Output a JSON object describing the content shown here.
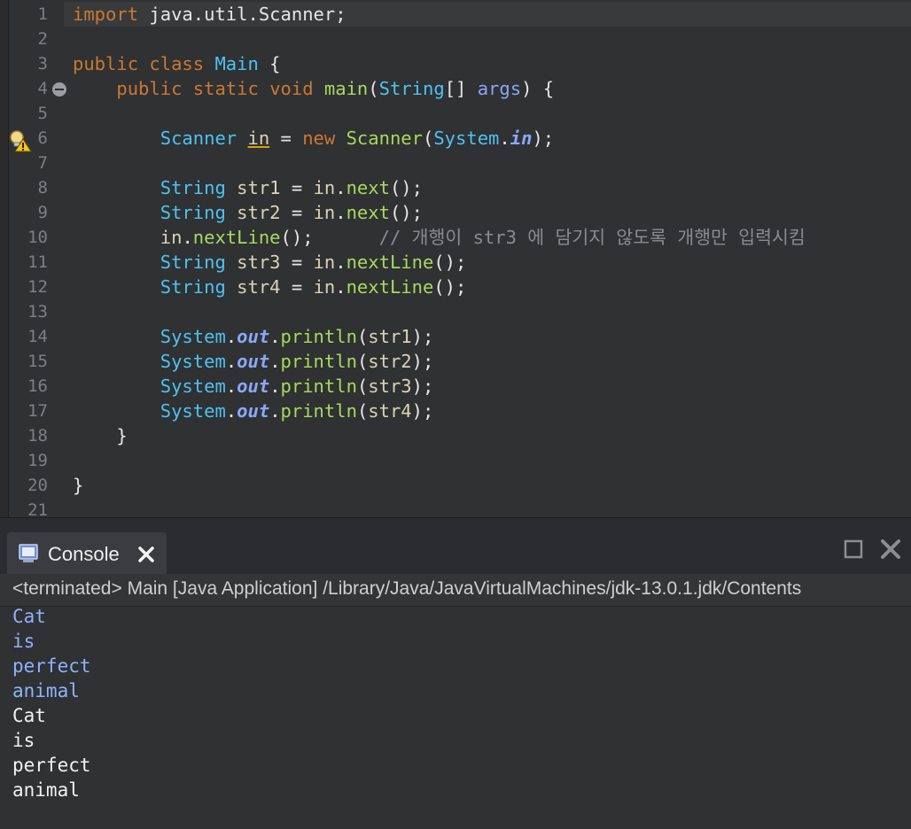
{
  "editor": {
    "line_numbers": [
      "1",
      "2",
      "3",
      "4",
      "5",
      "6",
      "7",
      "8",
      "9",
      "10",
      "11",
      "12",
      "13",
      "14",
      "15",
      "16",
      "17",
      "18",
      "19",
      "20",
      "21"
    ],
    "lines": {
      "l1": [
        [
          "kw",
          "import"
        ],
        [
          "p",
          " java.util.Scanner;"
        ]
      ],
      "l3": [
        [
          "kw",
          "public"
        ],
        [
          "p",
          " "
        ],
        [
          "kw",
          "class"
        ],
        [
          "p",
          " "
        ],
        [
          "ty",
          "Main"
        ],
        [
          "p",
          " {"
        ]
      ],
      "l4": [
        [
          "p",
          "    "
        ],
        [
          "kw",
          "public"
        ],
        [
          "p",
          " "
        ],
        [
          "kw",
          "static"
        ],
        [
          "p",
          " "
        ],
        [
          "kw",
          "void"
        ],
        [
          "p",
          " "
        ],
        [
          "mth",
          "main"
        ],
        [
          "p",
          "("
        ],
        [
          "ty",
          "String"
        ],
        [
          "p",
          "[] "
        ],
        [
          "arg",
          "args"
        ],
        [
          "p",
          ") {"
        ]
      ],
      "l6": [
        [
          "p",
          "        "
        ],
        [
          "ty",
          "Scanner"
        ],
        [
          "p",
          " "
        ],
        [
          "warnvar",
          "in"
        ],
        [
          "p",
          " = "
        ],
        [
          "kw",
          "new"
        ],
        [
          "p",
          " "
        ],
        [
          "cls",
          "Scanner"
        ],
        [
          "p",
          "("
        ],
        [
          "ty",
          "System"
        ],
        [
          "p",
          "."
        ],
        [
          "it",
          "in"
        ],
        [
          "p",
          ");"
        ]
      ],
      "l8": [
        [
          "p",
          "        "
        ],
        [
          "ty",
          "String"
        ],
        [
          "p",
          " "
        ],
        [
          "var",
          "str1"
        ],
        [
          "p",
          " = "
        ],
        [
          "var",
          "in"
        ],
        [
          "p",
          "."
        ],
        [
          "mth",
          "next"
        ],
        [
          "p",
          "();"
        ]
      ],
      "l9": [
        [
          "p",
          "        "
        ],
        [
          "ty",
          "String"
        ],
        [
          "p",
          " "
        ],
        [
          "var",
          "str2"
        ],
        [
          "p",
          " = "
        ],
        [
          "var",
          "in"
        ],
        [
          "p",
          "."
        ],
        [
          "mth",
          "next"
        ],
        [
          "p",
          "();"
        ]
      ],
      "l10": [
        [
          "p",
          "        "
        ],
        [
          "var",
          "in"
        ],
        [
          "p",
          "."
        ],
        [
          "mth",
          "nextLine"
        ],
        [
          "p",
          "();      "
        ],
        [
          "cmt",
          "// 개행이 str3 에 담기지 않도록 개행만 입력시킴"
        ]
      ],
      "l11": [
        [
          "p",
          "        "
        ],
        [
          "ty",
          "String"
        ],
        [
          "p",
          " "
        ],
        [
          "var",
          "str3"
        ],
        [
          "p",
          " = "
        ],
        [
          "var",
          "in"
        ],
        [
          "p",
          "."
        ],
        [
          "mth",
          "nextLine"
        ],
        [
          "p",
          "();"
        ]
      ],
      "l12": [
        [
          "p",
          "        "
        ],
        [
          "ty",
          "String"
        ],
        [
          "p",
          " "
        ],
        [
          "var",
          "str4"
        ],
        [
          "p",
          " = "
        ],
        [
          "var",
          "in"
        ],
        [
          "p",
          "."
        ],
        [
          "mth",
          "nextLine"
        ],
        [
          "p",
          "();"
        ]
      ],
      "l14": [
        [
          "p",
          "        "
        ],
        [
          "ty",
          "System"
        ],
        [
          "p",
          "."
        ],
        [
          "it",
          "out"
        ],
        [
          "p",
          "."
        ],
        [
          "mth",
          "println"
        ],
        [
          "p",
          "("
        ],
        [
          "var",
          "str1"
        ],
        [
          "p",
          ");"
        ]
      ],
      "l15": [
        [
          "p",
          "        "
        ],
        [
          "ty",
          "System"
        ],
        [
          "p",
          "."
        ],
        [
          "it",
          "out"
        ],
        [
          "p",
          "."
        ],
        [
          "mth",
          "println"
        ],
        [
          "p",
          "("
        ],
        [
          "var",
          "str2"
        ],
        [
          "p",
          ");"
        ]
      ],
      "l16": [
        [
          "p",
          "        "
        ],
        [
          "ty",
          "System"
        ],
        [
          "p",
          "."
        ],
        [
          "it",
          "out"
        ],
        [
          "p",
          "."
        ],
        [
          "mth",
          "println"
        ],
        [
          "p",
          "("
        ],
        [
          "var",
          "str3"
        ],
        [
          "p",
          ");"
        ]
      ],
      "l17": [
        [
          "p",
          "        "
        ],
        [
          "ty",
          "System"
        ],
        [
          "p",
          "."
        ],
        [
          "it",
          "out"
        ],
        [
          "p",
          "."
        ],
        [
          "mth",
          "println"
        ],
        [
          "p",
          "("
        ],
        [
          "var",
          "str4"
        ],
        [
          "p",
          ");"
        ]
      ],
      "l18": [
        [
          "p",
          "    }"
        ]
      ],
      "l20": [
        [
          "p",
          "}"
        ]
      ]
    }
  },
  "console": {
    "tab_label": "Console",
    "terminated_line": "<terminated> Main [Java Application] /Library/Java/JavaVirtualMachines/jdk-13.0.1.jdk/Contents",
    "input_lines": [
      "Cat",
      "is",
      "perfect",
      "animal"
    ],
    "output_lines": [
      "Cat",
      "is",
      "perfect",
      "animal"
    ]
  }
}
